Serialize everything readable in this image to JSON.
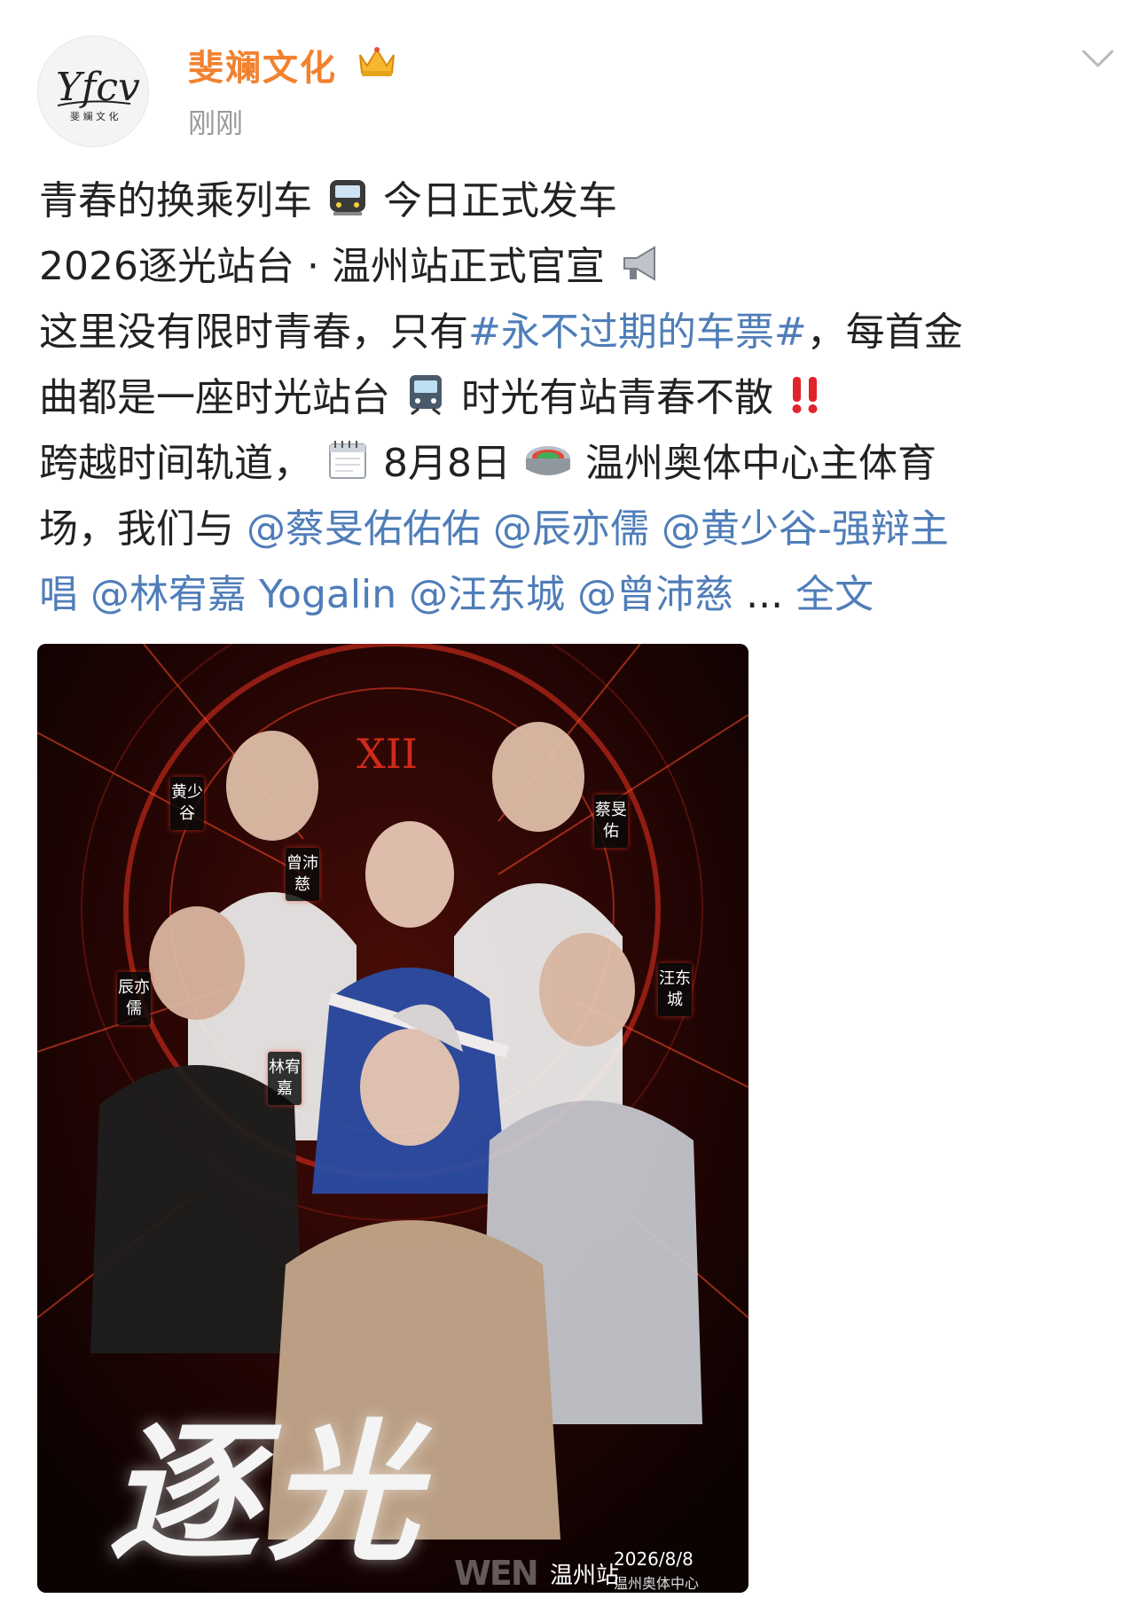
{
  "account": {
    "name": "斐斓文化",
    "post_time": "刚刚",
    "logo_text": "Yfcv",
    "logo_subtext": "斐 斓 文 化",
    "colors": {
      "name": "#f2812f",
      "link": "#4f7db8",
      "time": "#9a9a9a"
    }
  },
  "post": {
    "line1": {
      "a": "青春的换乘列车",
      "emoji": "metro-emoji",
      "b": "今日正式发车"
    },
    "line2": {
      "a": "2026逐光站台 · 温州站正式官宣",
      "emoji": "loudspeaker-emoji"
    },
    "line3": {
      "a": "这里没有限时青春，只有",
      "tag": "#永不过期的车票#",
      "b": "，每首金"
    },
    "line4": {
      "a": "曲都是一座时光站台",
      "emoji": "train-emoji",
      "b": "时光有站青春不散",
      "emoji2": "double-exclamation-emoji"
    },
    "line5": {
      "a": "跨越时间轨道，",
      "emoji": "calendar-emoji",
      "b": "8月8日",
      "emoji2": "stadium-emoji",
      "c": "温州奥体中心主体育"
    },
    "line6": {
      "a": "场，我们与 ",
      "m1": "@蔡旻佑佑佑",
      "m2": "@辰亦儒",
      "m3": "@黄少谷-强辩主"
    },
    "line7": {
      "m3b": "唱",
      "m4": "@林宥嘉 Yogalin",
      "m5": "@汪东城",
      "m6": "@曾沛慈",
      "ellipsis": "...",
      "more": "全文"
    }
  },
  "poster": {
    "title": "逐光",
    "clock_numeral": "XII",
    "names": {
      "huang": "黄少谷",
      "cai": "蔡旻佑",
      "zeng": "曾沛慈",
      "chen": "辰亦儒",
      "wang": "汪东城",
      "lin": "林宥嘉"
    },
    "brand": "WEN",
    "station": "温州站",
    "date": "2026/8/8",
    "venue": "温州奥体中心"
  }
}
